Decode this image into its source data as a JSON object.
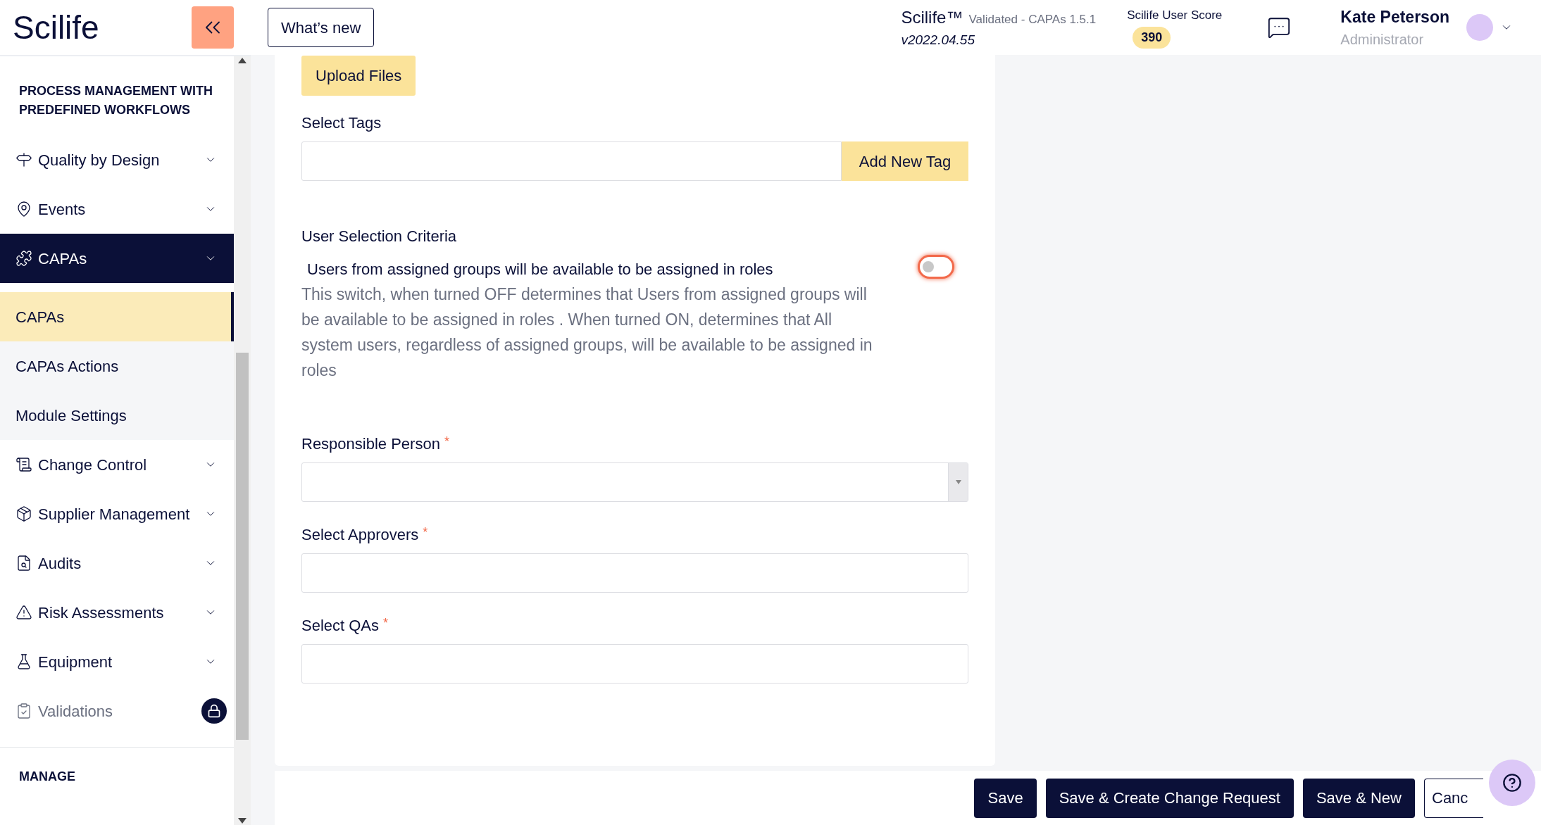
{
  "header": {
    "logo": "Scilife",
    "whats_new": "What’s new",
    "product": "Scilife™",
    "product_detail": "Validated - CAPAs 1.5.1",
    "version": "v2022.04.55",
    "score_label": "Scilife User Score",
    "score": "390",
    "user_name": "Kate Peterson",
    "user_role": "Administrator"
  },
  "sidebar": {
    "heading": "PROCESS MANAGEMENT WITH PREDEFINED WORKFLOWS",
    "items": [
      {
        "kind": "group",
        "label": "Quality by Design",
        "selected": false
      },
      {
        "kind": "group",
        "label": "Events",
        "selected": false
      },
      {
        "kind": "group",
        "label": "CAPAs",
        "selected": true
      },
      {
        "kind": "subitem",
        "label": "CAPAs",
        "selected": true
      },
      {
        "kind": "subitem",
        "label": "CAPAs Actions",
        "selected": false
      },
      {
        "kind": "subitem",
        "label": "Module Settings",
        "selected": false
      },
      {
        "kind": "group",
        "label": "Change Control",
        "selected": false
      },
      {
        "kind": "group",
        "label": "Supplier Management",
        "selected": false
      },
      {
        "kind": "group",
        "label": "Audits",
        "selected": false
      },
      {
        "kind": "group",
        "label": "Risk Assessments",
        "selected": false
      },
      {
        "kind": "group",
        "label": "Equipment",
        "selected": false
      },
      {
        "kind": "locked",
        "label": "Validations",
        "selected": false
      }
    ],
    "footer_heading": "MANAGE"
  },
  "form": {
    "upload_button": "Upload Files",
    "tags_label": "Select Tags",
    "add_tag_button": "Add New Tag",
    "criteria_title": "User Selection Criteria",
    "switch_label": "Users from assigned groups will be available to be assigned in roles",
    "switch_on": false,
    "switch_help": "This switch, when turned OFF determines that Users from assigned groups will be available to be assigned in roles . When turned ON, determines that All system users, regardless of assigned groups, will be available to be assigned in roles",
    "fields": [
      {
        "kind": "select",
        "label": "Responsible Person",
        "marker": "*"
      },
      {
        "kind": "text",
        "label": "Select Approvers",
        "marker": "*"
      },
      {
        "kind": "text",
        "label": "Select QAs",
        "marker": "*"
      }
    ]
  },
  "actions": [
    "Save",
    "Save & Create Change Request",
    "Save & New"
  ],
  "cancel": "Canc"
}
